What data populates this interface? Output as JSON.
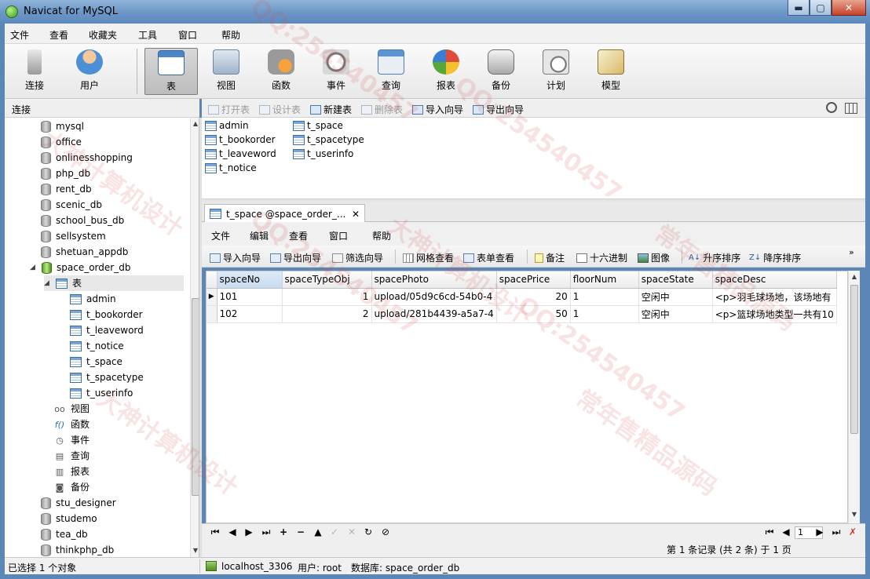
{
  "window": {
    "title": "Navicat for MySQL",
    "min": "▬",
    "max": "▢",
    "close": "✕"
  },
  "menu": [
    "文件",
    "查看",
    "收藏夹",
    "工具",
    "窗口",
    "帮助"
  ],
  "toolbar": [
    "连接",
    "用户",
    "表",
    "视图",
    "函数",
    "事件",
    "查询",
    "报表",
    "备份",
    "计划",
    "模型"
  ],
  "toolbar_active": "表",
  "left_header": "连接",
  "object_toolbar": [
    {
      "label": "打开表",
      "enabled": false
    },
    {
      "label": "设计表",
      "enabled": false
    },
    {
      "label": "新建表",
      "enabled": true
    },
    {
      "label": "删除表",
      "enabled": false
    },
    {
      "label": "导入向导",
      "enabled": true
    },
    {
      "label": "导出向导",
      "enabled": true
    }
  ],
  "tree": {
    "databases_before": [
      "mysql",
      "office",
      "onlinesshopping",
      "php_db",
      "rent_db",
      "scenic_db",
      "school_bus_db",
      "sellsystem",
      "shetuan_appdb"
    ],
    "open_db": "space_order_db",
    "tables_node": "表",
    "tables": [
      "admin",
      "t_bookorder",
      "t_leaveword",
      "t_notice",
      "t_space",
      "t_spacetype",
      "t_userinfo"
    ],
    "other_nodes": [
      "视图",
      "函数",
      "事件",
      "查询",
      "报表",
      "备份"
    ],
    "databases_after": [
      "stu_designer",
      "studemo",
      "tea_db",
      "thinkphp_db"
    ]
  },
  "objects": [
    "admin",
    "t_bookorder",
    "t_leaveword",
    "t_notice",
    "t_space",
    "t_spacetype",
    "t_userinfo"
  ],
  "tab": {
    "label": "t_space @space_order_...",
    "close": "✕"
  },
  "inner_menu": [
    "文件",
    "编辑",
    "查看",
    "窗口",
    "帮助"
  ],
  "inner_toolbar": [
    "导入向导",
    "导出向导",
    "筛选向导",
    "网格查看",
    "表单查看",
    "备注",
    "十六进制",
    "图像",
    "升序排序",
    "降序排序"
  ],
  "grid": {
    "columns": [
      "spaceNo",
      "spaceTypeObj",
      "spacePhoto",
      "spacePrice",
      "floorNum",
      "spaceState",
      "spaceDesc"
    ],
    "rows": [
      [
        "101",
        "1",
        "upload/05d9c6cd-54b0-4",
        "20",
        "1",
        "空闲中",
        "<p>羽毛球场地，该场地有"
      ],
      [
        "102",
        "2",
        "upload/281b4439-a5a7-4",
        "50",
        "1",
        "空闲中",
        "<p>篮球场地类型一共有10"
      ]
    ],
    "current_row_marker": "▶"
  },
  "nav": {
    "page": "1",
    "record_info": "第 1 条记录 (共 2 条) 于 1 页"
  },
  "status": {
    "left": "已选择 1 个对象",
    "connection": "localhost_3306",
    "user": "用户: root",
    "database": "数据库: space_order_db"
  },
  "watermarks": [
    "大神计算机设计",
    "QQ:254540457",
    "常年售精品源码"
  ]
}
